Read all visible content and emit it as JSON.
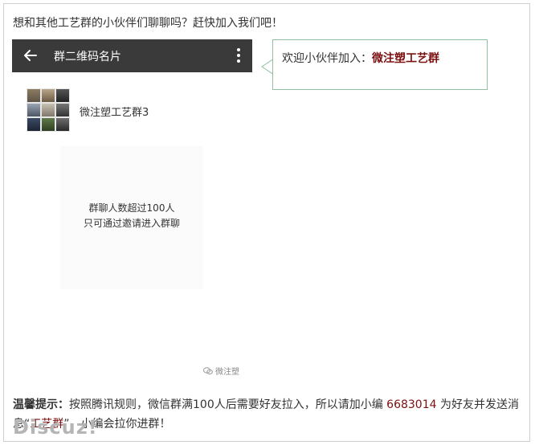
{
  "intro": "想和其他工艺群的小伙伴们聊聊吗？赶快加入我们吧！",
  "phone": {
    "title": "群二维码名片",
    "back_icon": "arrow-left-icon",
    "more_icon": "more-vertical-icon",
    "group_name": "微注塑工艺群3",
    "qr_notice": [
      "群聊人数超过100人",
      "只可通过邀请进入群聊"
    ],
    "watermark": "微注塑"
  },
  "bubble": {
    "prefix": "欢迎小伙伴加入：",
    "accent": "微注塑工艺群"
  },
  "tips": {
    "label": "温馨提示：",
    "text1": "按照腾讯规则，微信群满100人后需要好友拉入，所以请加小编 ",
    "number": "6683014",
    "text2": " 为好友并发送消息“",
    "accent": "工艺群",
    "text3": "”，小编会拉你进群！"
  },
  "logo": "Discuz!",
  "colors": {
    "accent": "#7a1010",
    "bar": "#3a3a3a",
    "bubble_border": "#8fc0a0"
  }
}
